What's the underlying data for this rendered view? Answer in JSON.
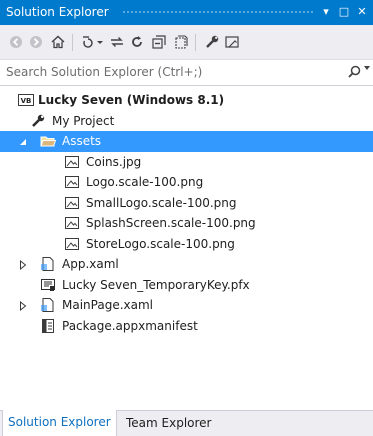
{
  "window": {
    "title": "Solution Explorer",
    "pin_glyph": "▾",
    "maximize_glyph": "□",
    "close_glyph": "✕"
  },
  "toolbar": {
    "items": [
      "back-icon",
      "forward-icon",
      "home-icon",
      "sync-with-active-document-icon",
      "pending-changes-filter-icon",
      "refresh-icon",
      "collapse-all-icon",
      "show-all-files-icon",
      "properties-icon",
      "preview-selected-items-icon"
    ]
  },
  "search": {
    "placeholder": "Search Solution Explorer (Ctrl+;)"
  },
  "tree": {
    "solution": "Lucky Seven (Windows 8.1)",
    "solution_badge": "VB",
    "my_project": "My Project",
    "assets": "Assets",
    "assets_children": [
      "Coins.jpg",
      "Logo.scale-100.png",
      "SmallLogo.scale-100.png",
      "SplashScreen.scale-100.png",
      "StoreLogo.scale-100.png"
    ],
    "app_xaml": "App.xaml",
    "key_pfx": "Lucky Seven_TemporaryKey.pfx",
    "mainpage_xaml": "MainPage.xaml",
    "manifest": "Package.appxmanifest"
  },
  "tabs": {
    "active": "Solution Explorer",
    "inactive": "Team Explorer"
  },
  "colors": {
    "accent": "#007acc",
    "selection": "#3399ff",
    "toolbar_bg": "#eeeef2"
  }
}
